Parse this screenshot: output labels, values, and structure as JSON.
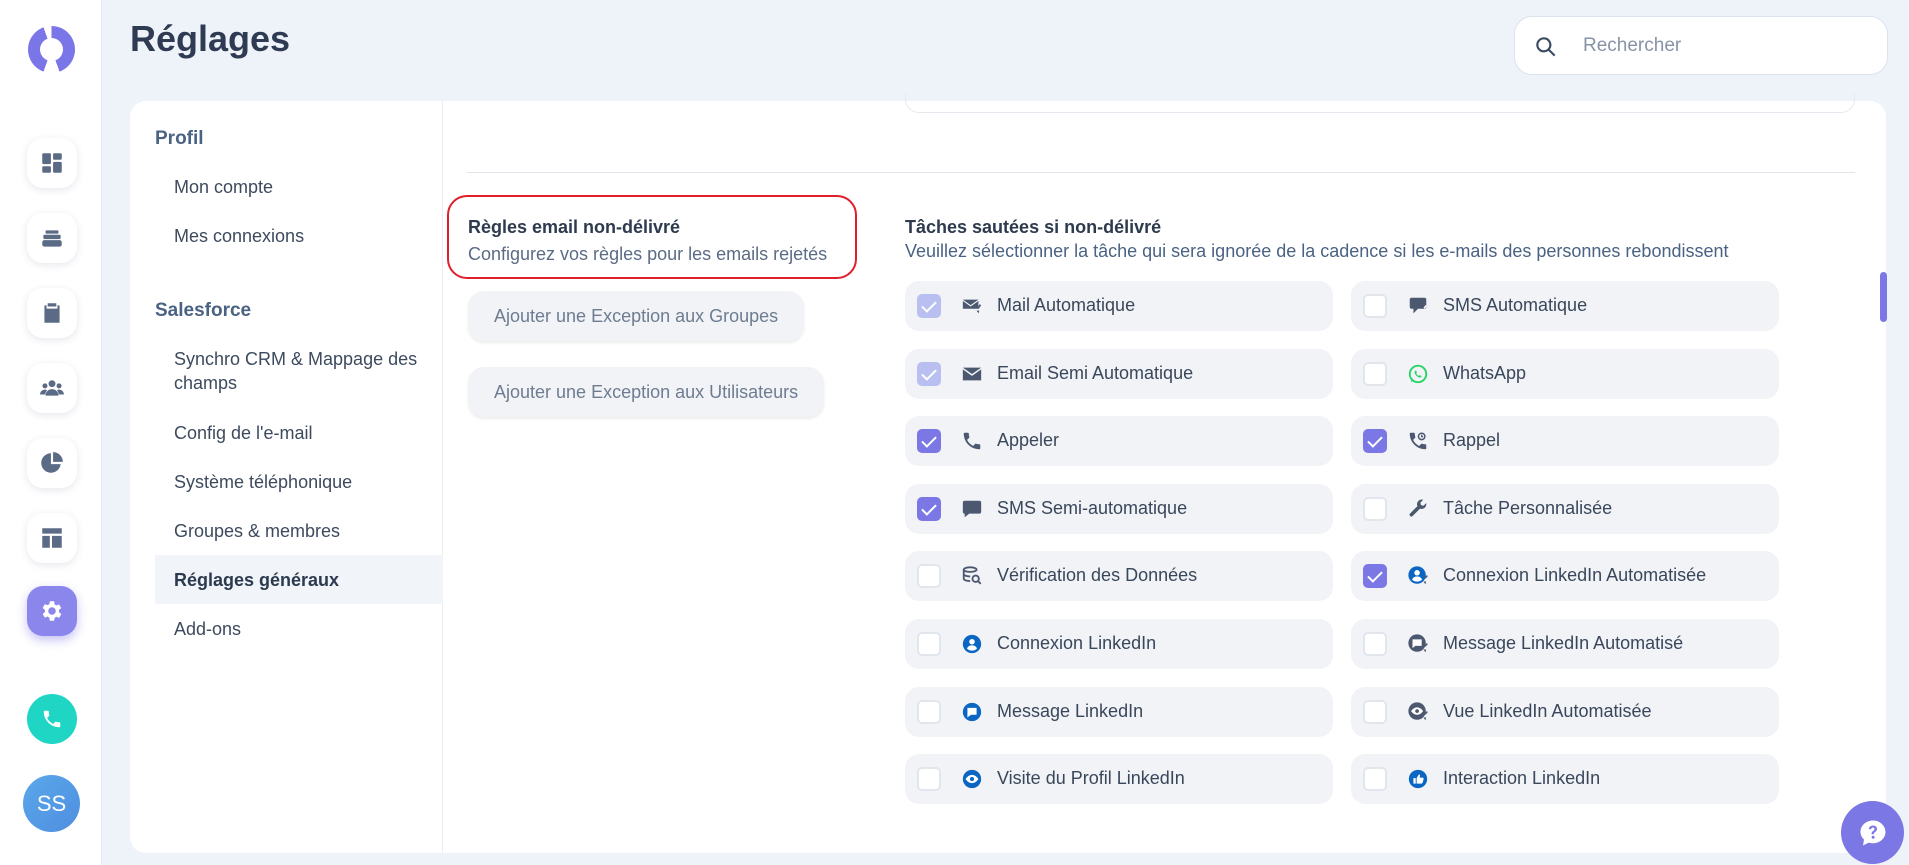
{
  "header": {
    "title": "Réglages",
    "search_placeholder": "Rechercher"
  },
  "rail": {
    "icons": [
      "dashboard-icon",
      "layers-icon",
      "clipboard-icon",
      "users-icon",
      "pie-chart-icon",
      "template-icon",
      "gear-icon"
    ],
    "active": "gear-icon",
    "avatar_initials": "SS"
  },
  "subnav": {
    "profil_title": "Profil",
    "profil_items": [
      "Mon compte",
      "Mes connexions"
    ],
    "salesforce_title": "Salesforce",
    "salesforce_items": [
      "Synchro CRM & Mappage des champs",
      "Config de l'e-mail",
      "Système téléphonique",
      "Groupes & membres",
      "Réglages généraux",
      "Add-ons"
    ],
    "active_item": "Réglages généraux"
  },
  "rules": {
    "title": "Règles email non-délivré",
    "subtitle": "Configurez vos règles pour les emails rejetés",
    "btn_groups": "Ajouter une Exception aux Groupes",
    "btn_users": "Ajouter une Exception aux Utilisateurs"
  },
  "tasks": {
    "title": "Tâches sautées si non-délivré",
    "subtitle": "Veuillez sélectionner la tâche qui sera ignorée de la cadence si les e-mails des personnes rebondissent",
    "items": [
      {
        "label": "Mail Automatique",
        "state": "disabled",
        "icon": "mail-auto-icon"
      },
      {
        "label": "SMS Automatique",
        "state": "unchecked",
        "icon": "sms-auto-icon"
      },
      {
        "label": "Email Semi Automatique",
        "state": "disabled",
        "icon": "envelope-icon"
      },
      {
        "label": "WhatsApp",
        "state": "unchecked",
        "icon": "whatsapp-icon"
      },
      {
        "label": "Appeler",
        "state": "checked",
        "icon": "phone-icon"
      },
      {
        "label": "Rappel",
        "state": "checked",
        "icon": "callback-icon"
      },
      {
        "label": "SMS Semi-automatique",
        "state": "checked",
        "icon": "chat-bubble-icon"
      },
      {
        "label": "Tâche Personnalisée",
        "state": "unchecked",
        "icon": "wrench-icon"
      },
      {
        "label": "Vérification des Données",
        "state": "unchecked",
        "icon": "data-check-icon"
      },
      {
        "label": "Connexion LinkedIn Automatisée",
        "state": "checked",
        "icon": "linkedin-auto-connect-icon"
      },
      {
        "label": "Connexion LinkedIn",
        "state": "unchecked",
        "icon": "linkedin-connect-icon"
      },
      {
        "label": "Message LinkedIn Automatisé",
        "state": "unchecked",
        "icon": "linkedin-auto-message-icon"
      },
      {
        "label": "Message LinkedIn",
        "state": "unchecked",
        "icon": "linkedin-message-icon"
      },
      {
        "label": "Vue LinkedIn Automatisée",
        "state": "unchecked",
        "icon": "linkedin-auto-view-icon"
      },
      {
        "label": "Visite du Profil LinkedIn",
        "state": "unchecked",
        "icon": "linkedin-visit-icon"
      },
      {
        "label": "Interaction LinkedIn",
        "state": "unchecked",
        "icon": "linkedin-interaction-icon"
      }
    ]
  },
  "colors": {
    "accent": "#7b77e4",
    "linkedin": "#0a66c2",
    "whatsapp": "#25d366",
    "highlight_border": "#e01e2c"
  }
}
